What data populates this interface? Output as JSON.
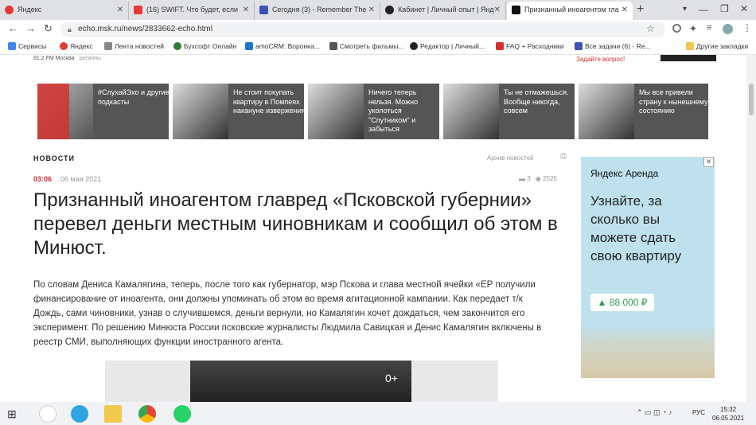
{
  "tabs": [
    {
      "title": "Яндекс",
      "color": "#e53935"
    },
    {
      "title": "(16) SWIFT. Что будет, если",
      "color": "#e53935"
    },
    {
      "title": "Сегодня (3) - Remember The",
      "color": "#3f51b5"
    },
    {
      "title": "Кабинет | Личный опыт | Янд",
      "color": "#222222"
    },
    {
      "title": "Признанный иноагентом гла",
      "color": "#111111"
    }
  ],
  "url": "echo.msk.ru/news/2833662-echo.html",
  "bookmarks": [
    {
      "label": "Сервисы",
      "color": "#4285f4"
    },
    {
      "label": "Яндекс",
      "color": "#e53935"
    },
    {
      "label": "Лента новостей",
      "color": "#888888"
    },
    {
      "label": "Бухсофт Онлайн",
      "color": "#2e7d32"
    },
    {
      "label": "amoCRM: Воронка...",
      "color": "#1976d2"
    },
    {
      "label": "Смотреть фильмы...",
      "color": "#555555"
    },
    {
      "label": "Редактор | Личный...",
      "color": "#222222"
    },
    {
      "label": "FAQ + Расходники",
      "color": "#d32f2f"
    },
    {
      "label": "Все задачи (6) - Re...",
      "color": "#3f51b5"
    }
  ],
  "bookmarks_other": "Другие закладки",
  "header": {
    "station": "91.2 FM Москва",
    "regions": "регионы",
    "ask": "Задайте вопрос!"
  },
  "cards": [
    {
      "caption": "#СлухайЭхо и другие подкасты"
    },
    {
      "caption": "Не стоит покупать квартиру в Помпеях накануне извержения"
    },
    {
      "caption": "Ничего теперь нельзя. Можно уколоться \"Спутником\" и забыться"
    },
    {
      "caption": "Ты не отмажешься. Вообще никогда, совсем"
    },
    {
      "caption": "Мы все привели страну к нынешнему состоянию"
    }
  ],
  "article": {
    "section": "НОВОСТИ",
    "archive": "Архив новостей",
    "time": "03:06",
    "date": "06 мая 2021",
    "comments": "3",
    "views": "2525",
    "headline": "Признанный иноагентом главред «Псковской губернии» перевел деньги местным чиновникам и сообщил об этом в Минюст.",
    "body": "По словам Дениса Камалягина, теперь, после того как губернатор, мэр Пскова и глава местной ячейки «ЕР получили финансирование от иноагента, они должны упоминать об этом во время агитационной кампании. Как передает т/к Дождь, сами чиновники, узнав о случившемся, деньги вернули, но Камалягин хочет дождаться, чем закончится его эксперимент. По решению Минюста России псковские журналисты Людмила Савицкая и Денис Камалягин включены в реестр СМИ, выполняющих функции иностранного агента.",
    "photo_count": "0+"
  },
  "ad": {
    "brand": "Яндекс Аренда",
    "text": "Узнайте, за сколько вы можете сдать свою квартиру",
    "price": "▲ 88 000 ₽"
  },
  "taskbar": {
    "lang": "РУС",
    "time": "15:32",
    "date": "06.05.2021"
  }
}
